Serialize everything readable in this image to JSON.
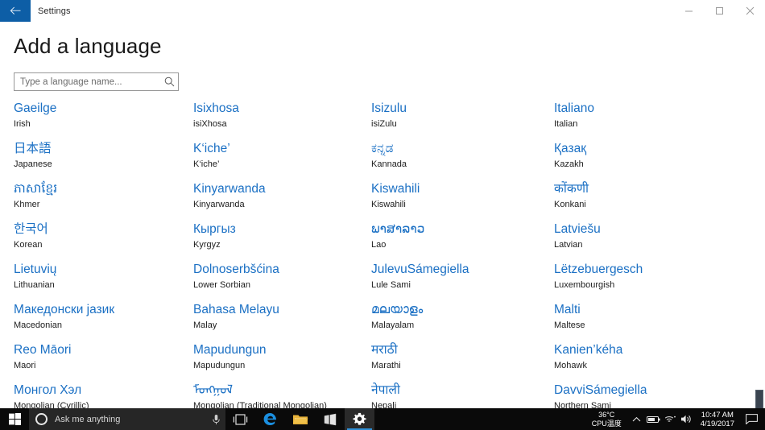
{
  "window": {
    "title": "Settings",
    "back_icon": "back-arrow-icon",
    "minimize_label": "─",
    "maximize_label": "❐",
    "close_label": "✕",
    "accent_color": "#0d5ea6"
  },
  "page": {
    "title": "Add a language",
    "link_color": "#1b70c4"
  },
  "search": {
    "placeholder": "Type a language name...",
    "value": "",
    "icon": "search-icon"
  },
  "languages": [
    {
      "native": "Gaeilge",
      "english": "Irish"
    },
    {
      "native": "Isixhosa",
      "english": "isiXhosa"
    },
    {
      "native": "Isizulu",
      "english": "isiZulu"
    },
    {
      "native": "Italiano",
      "english": "Italian"
    },
    {
      "native": "日本語",
      "english": "Japanese"
    },
    {
      "native": "K‘iche’",
      "english": "K‘iche’"
    },
    {
      "native": "ಕನ್ನಡ",
      "english": "Kannada"
    },
    {
      "native": "Қазақ",
      "english": "Kazakh"
    },
    {
      "native": "ភាសាខ្មែរ",
      "english": "Khmer"
    },
    {
      "native": "Kinyarwanda",
      "english": "Kinyarwanda"
    },
    {
      "native": "Kiswahili",
      "english": "Kiswahili"
    },
    {
      "native": "कोंकणी",
      "english": "Konkani"
    },
    {
      "native": "한국어",
      "english": "Korean"
    },
    {
      "native": "Кыргыз",
      "english": "Kyrgyz"
    },
    {
      "native": "ພາສາລາວ",
      "english": "Lao"
    },
    {
      "native": "Latviešu",
      "english": "Latvian"
    },
    {
      "native": "Lietuvių",
      "english": "Lithuanian"
    },
    {
      "native": "Dolnoserbšćina",
      "english": "Lower Sorbian"
    },
    {
      "native": "JulevuSámegiella",
      "english": "Lule Sami"
    },
    {
      "native": "Lëtzebuergesch",
      "english": "Luxembourgish"
    },
    {
      "native": "Македонски јазик",
      "english": "Macedonian"
    },
    {
      "native": "Bahasa Melayu",
      "english": "Malay"
    },
    {
      "native": "മലയാളം",
      "english": "Malayalam"
    },
    {
      "native": "Malti",
      "english": "Maltese"
    },
    {
      "native": "Reo Māori",
      "english": "Maori"
    },
    {
      "native": "Mapudungun",
      "english": "Mapudungun"
    },
    {
      "native": "मराठी",
      "english": "Marathi"
    },
    {
      "native": "Kanien’kéha",
      "english": "Mohawk"
    },
    {
      "native": "Монгол Хэл",
      "english": "Mongolian (Cyrillic)"
    },
    {
      "native": "ᠮᠣᠩᠭᠣᠯ",
      "english": "Mongolian (Traditional Mongolian)"
    },
    {
      "native": "नेपाली",
      "english": "Nepali"
    },
    {
      "native": "DavviSámegiella",
      "english": "Northern Sami"
    }
  ],
  "taskbar": {
    "start_icon": "windows-start-icon",
    "cortana_icon": "cortana-circle-icon",
    "search_placeholder": "Ask me anything",
    "mic_icon": "microphone-icon",
    "items": [
      {
        "name": "task-view-icon",
        "label": "Task View"
      },
      {
        "name": "edge-icon",
        "label": "Microsoft Edge"
      },
      {
        "name": "file-explorer-icon",
        "label": "File Explorer"
      },
      {
        "name": "store-icon",
        "label": "Microsoft Store"
      },
      {
        "name": "settings-icon",
        "label": "Settings"
      }
    ],
    "tray": {
      "cpu_temp": "36°C",
      "cpu_label": "CPU温度",
      "chevron_icon": "chevron-up-icon",
      "battery_icon": "battery-icon",
      "network_icon": "wifi-icon",
      "volume_icon": "speaker-icon",
      "time": "10:47 AM",
      "date": "4/19/2017",
      "action_center_icon": "action-center-icon"
    }
  }
}
